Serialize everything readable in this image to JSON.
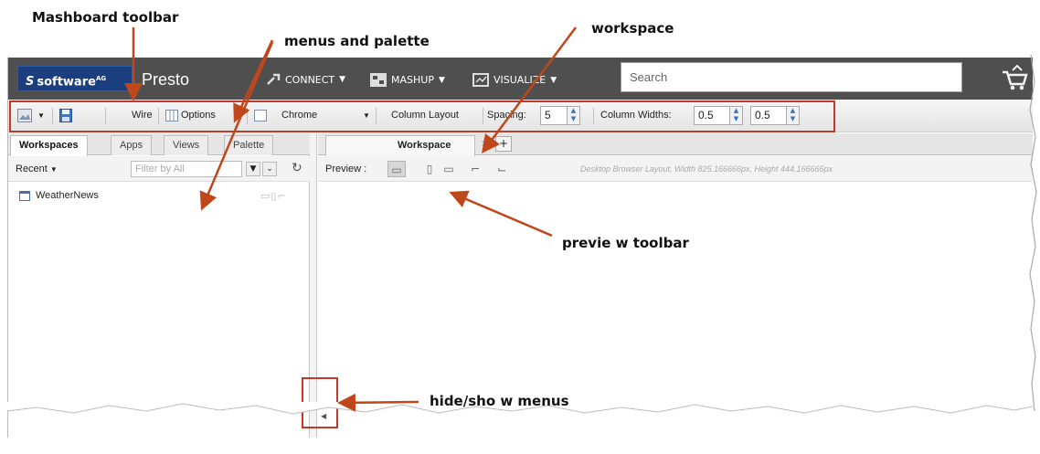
{
  "annotations": {
    "mashboard_toolbar": "Mashboard toolbar",
    "menus_palette": "menus and palette",
    "workspace": "workspace",
    "preview_toolbar": "previe w toolbar",
    "hide_show": "hide/sho w menus"
  },
  "header": {
    "logo_prefix": "S",
    "logo_text": "software",
    "logo_tm": "AG",
    "app_name": "Presto",
    "nav": [
      {
        "label": "CONNECT",
        "icon": "plug-icon"
      },
      {
        "label": "MASHUP",
        "icon": "mashup-icon"
      },
      {
        "label": "VISUALIZE",
        "icon": "visualize-icon"
      }
    ],
    "search_placeholder": "Search",
    "cart_icon": "cart-icon"
  },
  "toolbar": {
    "wire": "Wire",
    "options": "Options",
    "chrome": "Chrome",
    "column_layout": "Column Layout",
    "spacing_label": "Spacing:",
    "spacing_value": "5",
    "column_widths_label": "Column Widths:",
    "col_width_1": "0.5",
    "col_width_2": "0.5"
  },
  "left_panel": {
    "tabs": [
      "Workspaces",
      "Apps",
      "Views",
      "Palette"
    ],
    "recent": "Recent",
    "filter_placeholder": "Filter by All",
    "items": [
      {
        "label": "WeatherNews"
      }
    ]
  },
  "workspace": {
    "tab_label": "Workspace",
    "add_tab": "+",
    "close_tab": "×",
    "preview_label": "Preview :",
    "layout_info": "Desktop Browser Layout, Width 825.166666px, Height 444.166666px"
  },
  "colors": {
    "header_bg": "#4f4f4f",
    "logo_bg": "#1b3f7e",
    "highlight_red": "#c0392b",
    "arrow": "#c0461b"
  }
}
